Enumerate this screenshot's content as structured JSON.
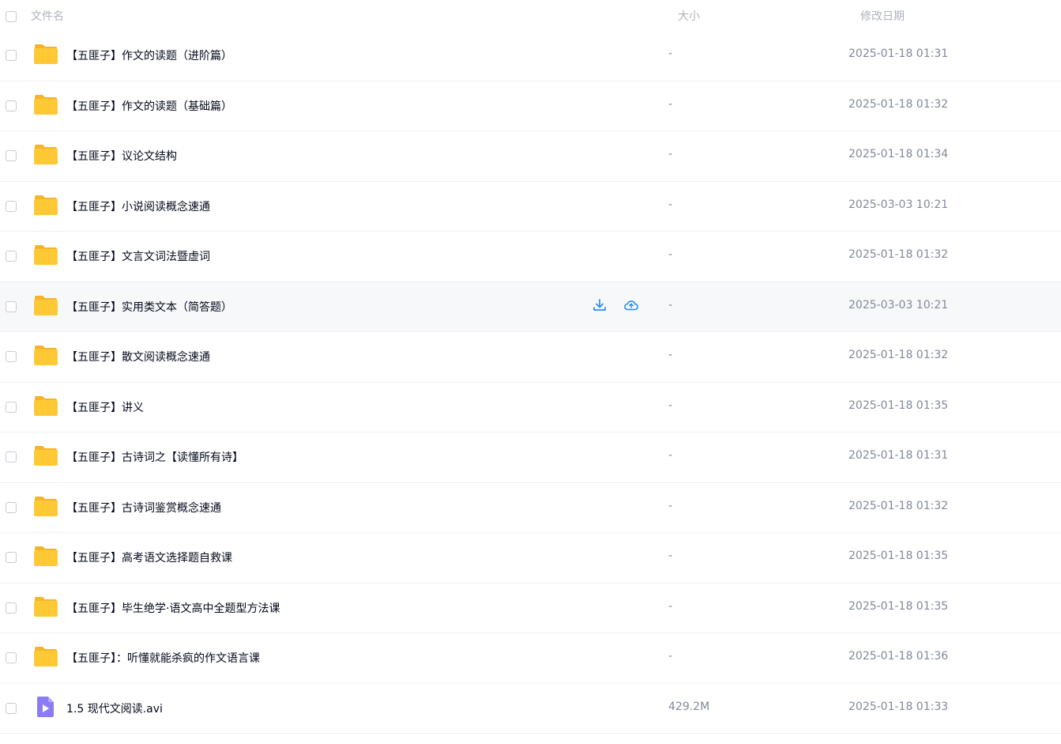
{
  "header": {
    "name_label": "文件名",
    "size_label": "大小",
    "date_label": "修改日期"
  },
  "rows": [
    {
      "type": "folder",
      "name": "【五匪子】作文的读题（进阶篇）",
      "size": "-",
      "date": "2025-01-18 01:31"
    },
    {
      "type": "folder",
      "name": "【五匪子】作文的读题（基础篇）",
      "size": "-",
      "date": "2025-01-18 01:32"
    },
    {
      "type": "folder",
      "name": "【五匪子】议论文结构",
      "size": "-",
      "date": "2025-01-18 01:34"
    },
    {
      "type": "folder",
      "name": "【五匪子】小说阅读概念速通",
      "size": "-",
      "date": "2025-03-03 10:21"
    },
    {
      "type": "folder",
      "name": "【五匪子】文言文词法暨虚词",
      "size": "-",
      "date": "2025-01-18 01:32"
    },
    {
      "type": "folder",
      "name": "【五匪子】实用类文本（简答题）",
      "size": "-",
      "date": "2025-03-03 10:21",
      "hovered": true
    },
    {
      "type": "folder",
      "name": "【五匪子】散文阅读概念速通",
      "size": "-",
      "date": "2025-01-18 01:32"
    },
    {
      "type": "folder",
      "name": "【五匪子】讲义",
      "size": "-",
      "date": "2025-01-18 01:35"
    },
    {
      "type": "folder",
      "name": "【五匪子】古诗词之【读懂所有诗】",
      "size": "-",
      "date": "2025-01-18 01:31"
    },
    {
      "type": "folder",
      "name": "【五匪子】古诗词鉴赏概念速通",
      "size": "-",
      "date": "2025-01-18 01:32"
    },
    {
      "type": "folder",
      "name": "【五匪子】高考语文选择题自救课",
      "size": "-",
      "date": "2025-01-18 01:35"
    },
    {
      "type": "folder",
      "name": "【五匪子】毕生绝学·语文高中全题型方法课",
      "size": "-",
      "date": "2025-01-18 01:35"
    },
    {
      "type": "folder",
      "name": "【五匪子】：听懂就能杀疯的作文语言课",
      "size": "-",
      "date": "2025-01-18 01:36"
    },
    {
      "type": "video",
      "name": "1.5 现代文阅读.avi",
      "size": "429.2M",
      "date": "2025-01-18 01:33"
    }
  ],
  "icons": {
    "folder": "folder-icon",
    "video": "video-file-icon",
    "download": "download-icon",
    "save": "cloud-save-icon"
  },
  "colors": {
    "folder": "#ffc936",
    "video": "#8b7cf6",
    "accent": "#2a8cf0"
  }
}
